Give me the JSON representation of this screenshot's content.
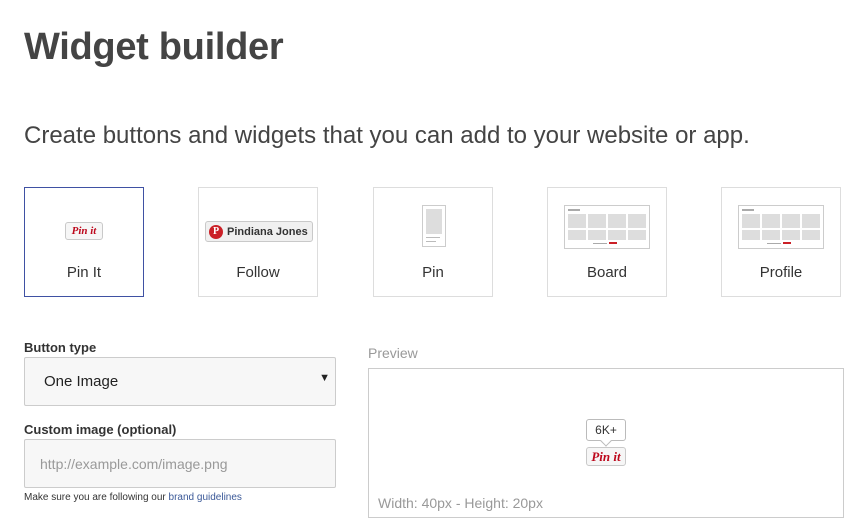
{
  "page": {
    "title": "Widget builder",
    "subtitle": "Create buttons and widgets that you can add to your website or app."
  },
  "widgets": [
    {
      "label": "Pin It",
      "selected": true,
      "thumb_text": "Pin it",
      "icon": "pin-it-button-icon"
    },
    {
      "label": "Follow",
      "selected": false,
      "thumb_text": "Pindiana Jones",
      "icon": "follow-button-icon"
    },
    {
      "label": "Pin",
      "selected": false,
      "icon": "pin-widget-icon"
    },
    {
      "label": "Board",
      "selected": false,
      "icon": "board-widget-icon"
    },
    {
      "label": "Profile",
      "selected": false,
      "icon": "profile-widget-icon"
    }
  ],
  "form": {
    "button_type_label": "Button type",
    "button_type_value": "One Image",
    "custom_image_label": "Custom image (optional)",
    "custom_image_placeholder": "http://example.com/image.png",
    "custom_image_value": "",
    "help_prefix": "Make sure you are following our",
    "help_link": "brand guidelines"
  },
  "preview": {
    "label": "Preview",
    "count": "6K+",
    "button_text": "Pin it",
    "dimensions": "Width: 40px - Height: 20px"
  },
  "colors": {
    "brand_red": "#cb2027",
    "selected_border": "#3f51a3",
    "link": "#3b5998"
  }
}
